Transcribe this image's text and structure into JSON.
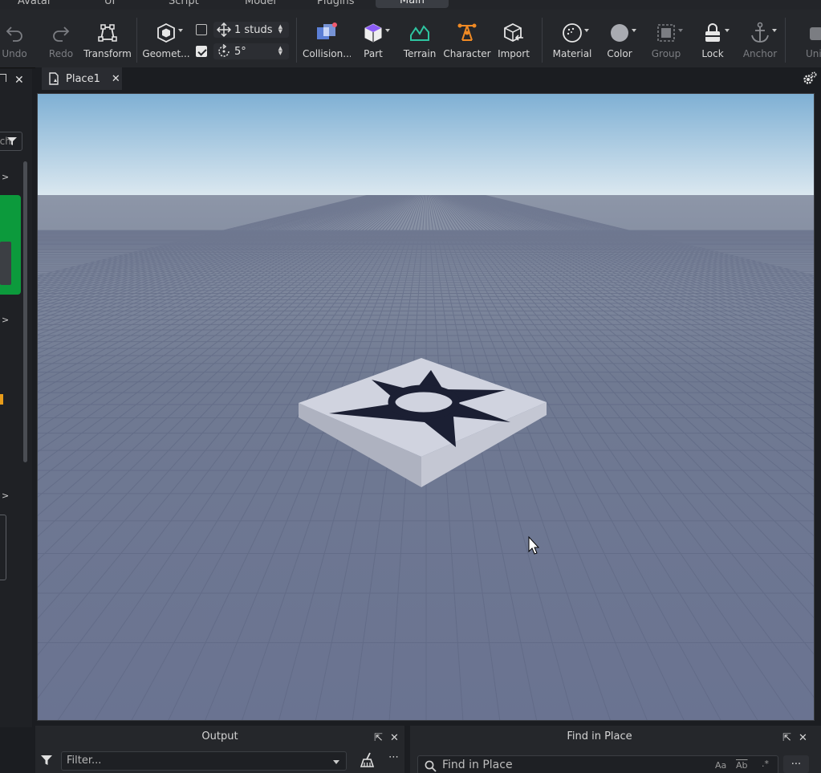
{
  "menu": {
    "tabs": [
      {
        "label": "Avatar"
      },
      {
        "label": "UI"
      },
      {
        "label": "Script"
      },
      {
        "label": "Model"
      },
      {
        "label": "Plugins"
      },
      {
        "label": "Main"
      }
    ]
  },
  "ribbon": {
    "undo": "Undo",
    "redo": "Redo",
    "transform": "Transform",
    "geometry": "Geomet...",
    "move_snap": "1 studs",
    "rotate_snap": "5°",
    "collisions": "Collision...",
    "part": "Part",
    "terrain": "Terrain",
    "character": "Character",
    "import": "Import",
    "material": "Material",
    "color": "Color",
    "group": "Group",
    "lock": "Lock",
    "anchor": "Anchor",
    "union": "Uni"
  },
  "leftdock": {
    "search_fragment": "rch"
  },
  "document": {
    "tab_title": "Place1"
  },
  "output": {
    "title": "Output",
    "filter_placeholder": "Filter..."
  },
  "find": {
    "title": "Find in Place",
    "search_placeholder": "Find in Place",
    "match_case": "Aa",
    "whole_word": "Ab",
    "regex": ".*",
    "more": "..."
  },
  "colors": {
    "sky_top": "#7fb0d4",
    "sky_horizon": "#dbe8f0",
    "floor": "#6e7790",
    "part_top": "#c8ccda",
    "decal": "#1b1f33",
    "terrain_accent": "#2ec4a0",
    "character_accent": "#f08a24",
    "part_accent": "#8b5cf6"
  }
}
